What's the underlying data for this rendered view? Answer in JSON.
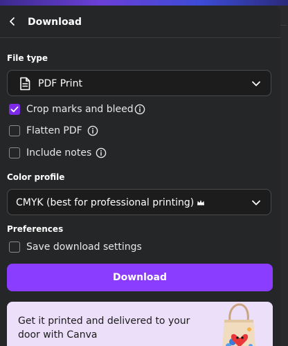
{
  "header": {
    "title": "Download",
    "back_icon": "chevron-left-icon"
  },
  "file_type": {
    "label": "File type",
    "selected": "PDF Print",
    "icon": "document-icon"
  },
  "pdf_options": [
    {
      "label": "Crop marks and bleed",
      "checked": true,
      "info": true
    },
    {
      "label": "Flatten PDF",
      "checked": false,
      "info": true
    },
    {
      "label": "Include notes",
      "checked": false,
      "info": true
    }
  ],
  "color_profile": {
    "label": "Color profile",
    "selected": "CMYK (best for professional printing)",
    "badge_icon": "crown-icon"
  },
  "preferences": {
    "label": "Preferences",
    "save_settings_label": "Save download settings",
    "save_settings_checked": false
  },
  "download_button": {
    "label": "Download"
  },
  "promo": {
    "text": "Get it printed and delivered to your door with Canva",
    "illustration": "tote-bag-illustration"
  },
  "colors": {
    "accent": "#8b3dff",
    "checkbox_checked": "#7d2ae8",
    "panel_bg": "#252627",
    "promo_bg": "#ecdff9"
  }
}
